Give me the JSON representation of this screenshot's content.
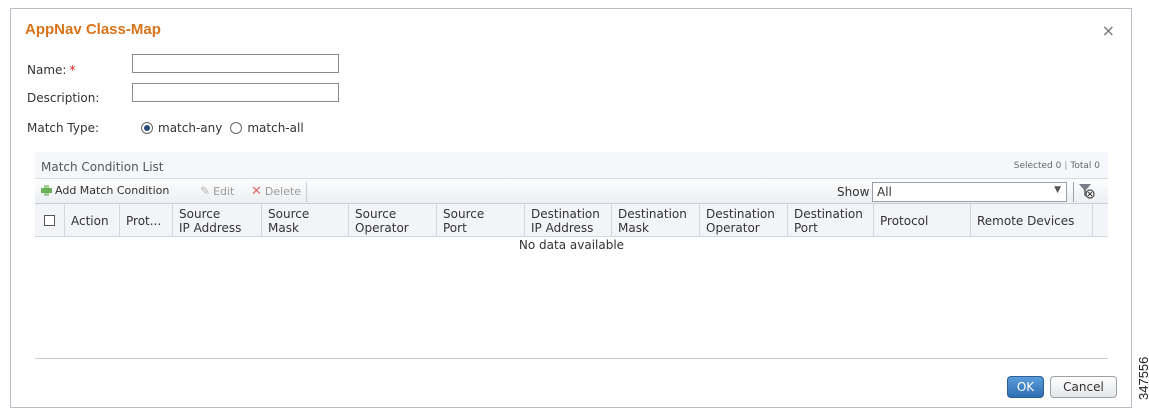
{
  "dialog": {
    "title": "AppNav Class-Map",
    "close_glyph": "×"
  },
  "form": {
    "name_label": "Name:",
    "required_mark": "*",
    "name_value": "",
    "description_label": "Description:",
    "description_value": "",
    "match_type_label": "Match Type:",
    "match_any_label": "match-any",
    "match_all_label": "match-all",
    "match_selected": "match-any"
  },
  "panel": {
    "title": "Match Condition List",
    "selected_text": "Selected 0",
    "total_text": "Total 0",
    "separator": "|"
  },
  "toolbar": {
    "add_label": "Add Match Condition",
    "edit_label": "Edit",
    "delete_label": "Delete",
    "show_label": "Show",
    "show_value": "All"
  },
  "grid": {
    "columns": [
      {
        "line1": "Action",
        "line2": ""
      },
      {
        "line1": "Prot...",
        "line2": ""
      },
      {
        "line1": "Source",
        "line2": "IP Address"
      },
      {
        "line1": "Source",
        "line2": "Mask"
      },
      {
        "line1": "Source",
        "line2": "Operator"
      },
      {
        "line1": "Source",
        "line2": "Port"
      },
      {
        "line1": "Destination",
        "line2": "IP Address"
      },
      {
        "line1": "Destination",
        "line2": "Mask"
      },
      {
        "line1": "Destination",
        "line2": "Operator"
      },
      {
        "line1": "Destination",
        "line2": "Port"
      },
      {
        "line1": "Protocol",
        "line2": ""
      },
      {
        "line1": "Remote Devices",
        "line2": ""
      }
    ],
    "empty_text": "No data available"
  },
  "buttons": {
    "ok_label": "OK",
    "cancel_label": "Cancel"
  },
  "figure_id": "347556",
  "colors": {
    "title": "#d8731a",
    "ok_button": "#2f70b5",
    "required": "#e02020"
  }
}
